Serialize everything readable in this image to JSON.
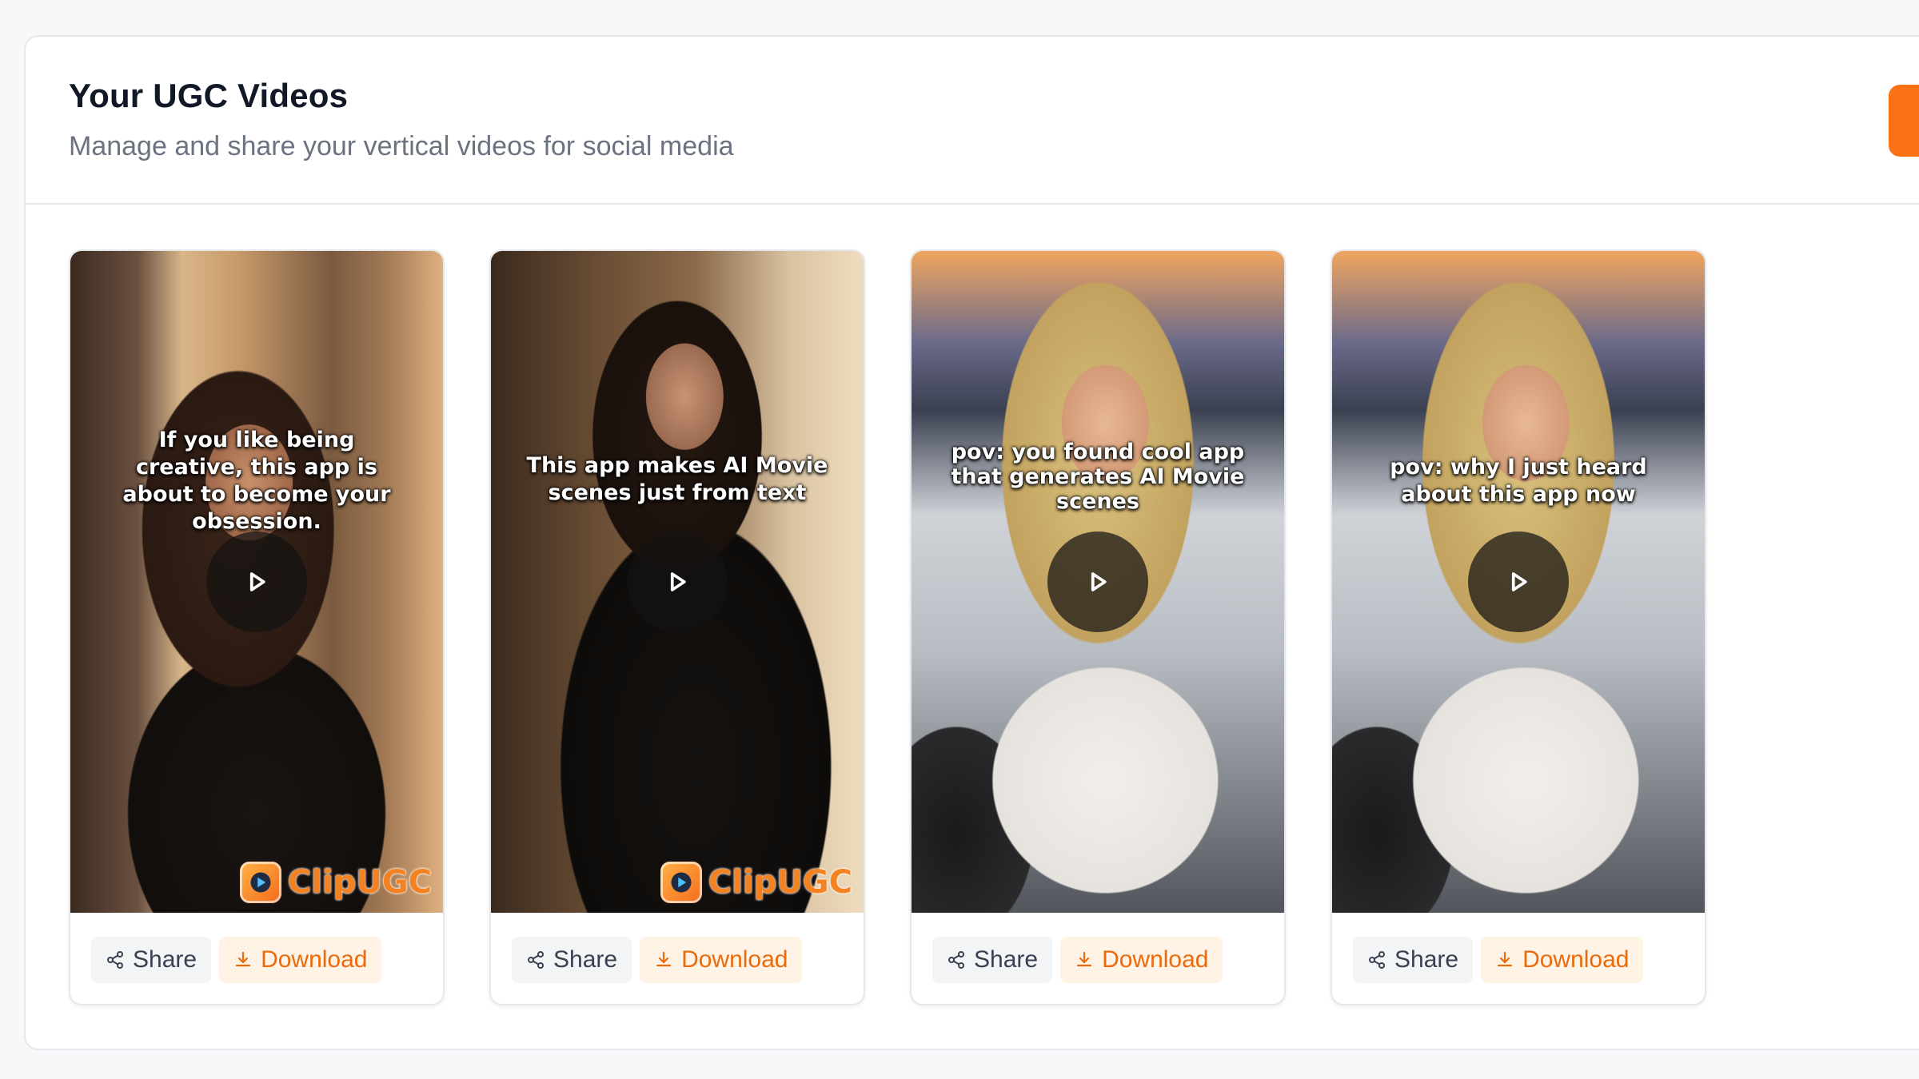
{
  "header": {
    "title": "Your UGC Videos",
    "subtitle": "Manage and share your vertical videos for social media"
  },
  "colors": {
    "accent": "#f97316",
    "download_text": "#ea6a0c",
    "download_bg": "#fff3e6",
    "share_bg": "#f3f4f6"
  },
  "videos": [
    {
      "caption": "If you like being creative, this app is about to become your obsession.",
      "brand": "ClipUGC",
      "share_label": "Share",
      "download_label": "Download"
    },
    {
      "caption": "This app makes AI Movie scenes just from text",
      "brand": "ClipUGC",
      "share_label": "Share",
      "download_label": "Download"
    },
    {
      "caption": "pov: you found cool app that generates AI Movie scenes",
      "share_label": "Share",
      "download_label": "Download"
    },
    {
      "caption": "pov: why I just heard about this app now",
      "share_label": "Share",
      "download_label": "Download"
    }
  ]
}
